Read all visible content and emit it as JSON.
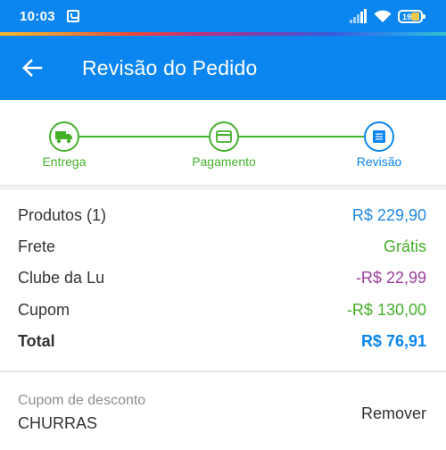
{
  "status_bar": {
    "time": "10:03",
    "battery_level": "19"
  },
  "colors": {
    "primary": "#0b86f0",
    "success": "#45b02b",
    "discount_purple": "#9c3d9c",
    "text": "#333333",
    "muted": "#8e8e8e"
  },
  "app_bar": {
    "title": "Revisão do Pedido",
    "back_icon": "arrow-left-icon"
  },
  "stepper": {
    "steps": [
      {
        "label": "Entrega",
        "icon": "truck-icon",
        "state": "done"
      },
      {
        "label": "Pagamento",
        "icon": "credit-card-icon",
        "state": "done"
      },
      {
        "label": "Revisão",
        "icon": "list-icon",
        "state": "active"
      }
    ]
  },
  "summary": {
    "rows": [
      {
        "label": "Produtos (1)",
        "value": "R$ 229,90",
        "color": "#1e88e5"
      },
      {
        "label": "Frete",
        "value": "Grátis",
        "color": "#45b02b"
      },
      {
        "label": "Clube da Lu",
        "value": "-R$ 22,99",
        "color": "#9c3d9c"
      },
      {
        "label": "Cupom",
        "value": "-R$ 130,00",
        "color": "#45b02b"
      }
    ],
    "total": {
      "label": "Total",
      "value": "R$ 76,91",
      "color": "#0b86f0"
    }
  },
  "coupon": {
    "caption": "Cupom de desconto",
    "code": "CHURRAS",
    "remove_label": "Remover"
  }
}
